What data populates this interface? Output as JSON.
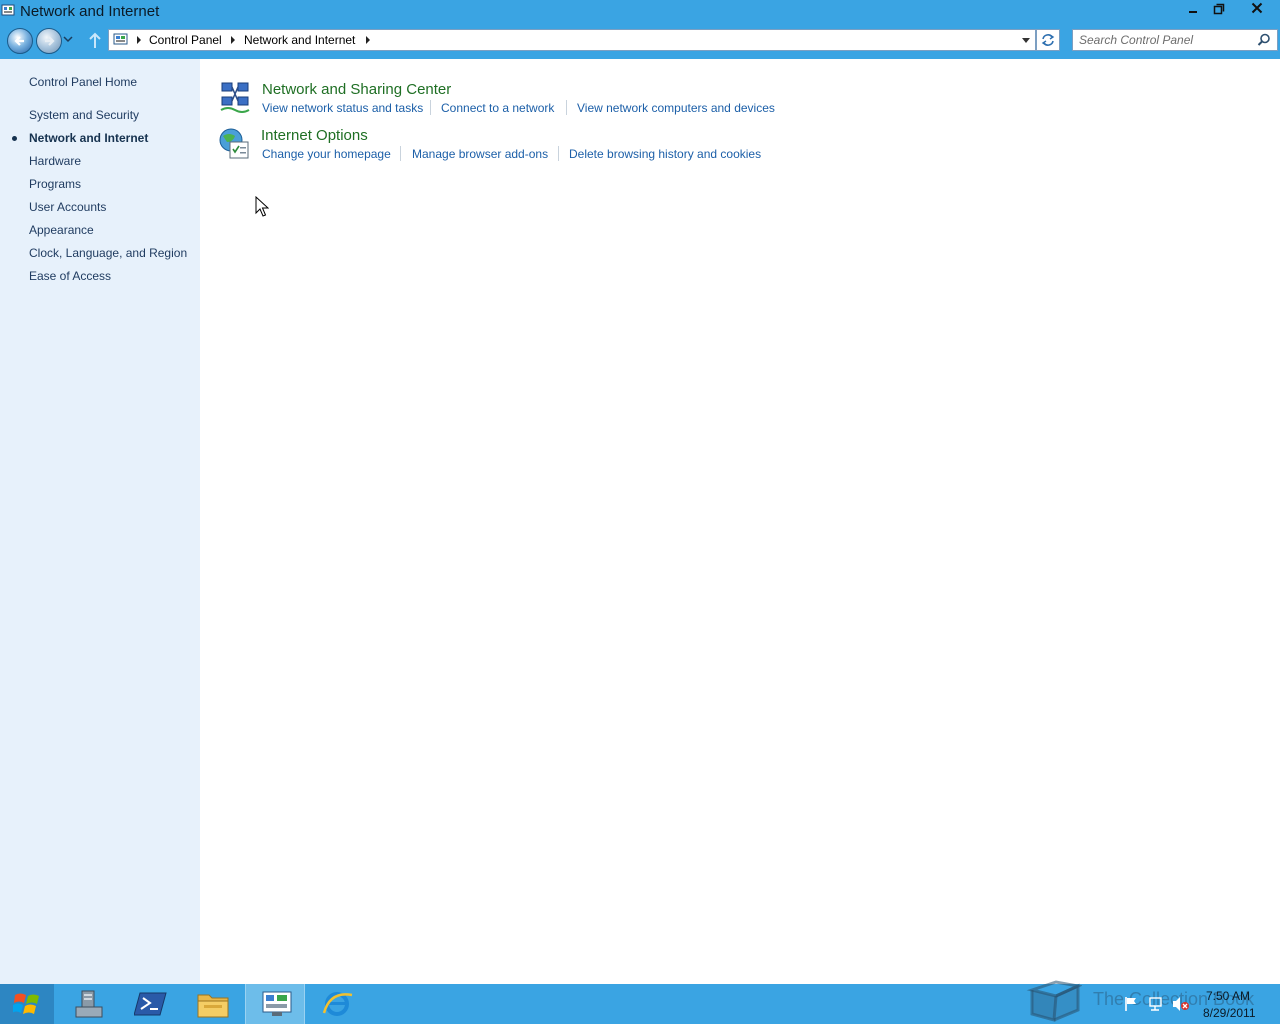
{
  "window": {
    "title": "Network and Internet",
    "controls": {
      "minimize": "minimize",
      "maximize": "restore",
      "close": "close"
    }
  },
  "address_bar": {
    "breadcrumbs": [
      "Control Panel",
      "Network and Internet"
    ],
    "search_placeholder": "Search Control Panel"
  },
  "sidebar": {
    "home": "Control Panel Home",
    "items": [
      {
        "label": "System and Security",
        "current": false
      },
      {
        "label": "Network and Internet",
        "current": true
      },
      {
        "label": "Hardware",
        "current": false
      },
      {
        "label": "Programs",
        "current": false
      },
      {
        "label": "User Accounts",
        "current": false
      },
      {
        "label": "Appearance",
        "current": false
      },
      {
        "label": "Clock, Language, and Region",
        "current": false
      },
      {
        "label": "Ease of Access",
        "current": false
      }
    ]
  },
  "categories": [
    {
      "title": "Network and Sharing Center",
      "icon": "network-sharing-center-icon",
      "tasks": [
        "View network status and tasks",
        "Connect to a network",
        "View network computers and devices"
      ]
    },
    {
      "title": "Internet Options",
      "icon": "internet-options-icon",
      "tasks": [
        "Change your homepage",
        "Manage browser add-ons",
        "Delete browsing history and cookies"
      ]
    }
  ],
  "taskbar": {
    "apps": [
      "server-manager-icon",
      "powershell-icon",
      "file-explorer-icon",
      "control-panel-icon",
      "internet-explorer-icon"
    ],
    "active_app": "control-panel-icon",
    "watermark": "The Collection Book",
    "clock_time": "7:50 AM",
    "clock_date": "8/29/2011"
  },
  "colors": {
    "chrome": "#3aa4e3",
    "sidebar": "#e7f1fb",
    "category_title": "#1f6f24",
    "task_link": "#1c5fa8"
  }
}
